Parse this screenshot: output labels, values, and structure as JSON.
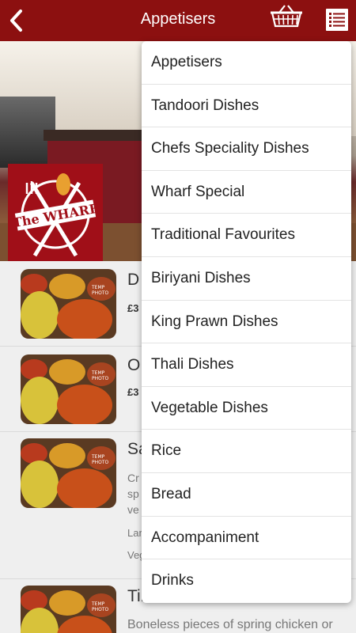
{
  "header": {
    "title": "Appetisers"
  },
  "menu": {
    "items": [
      "Appetisers",
      "Tandoori Dishes",
      "Chefs Speciality Dishes",
      "Wharf Special",
      "Traditional Favourites",
      "Biriyani Dishes",
      "King Prawn Dishes",
      "Thali Dishes",
      "Vegetable Dishes",
      "Rice",
      "Bread",
      "Accompaniment",
      "Drinks"
    ]
  },
  "logo": {
    "text": "The WHARF"
  },
  "list": {
    "items": [
      {
        "title": "D",
        "price": "£3"
      },
      {
        "title": "O",
        "price": "£3"
      },
      {
        "title": "Sa",
        "desc1": "Cr",
        "desc2": "sp",
        "desc3": "ve",
        "meta1": "Lar",
        "meta2": "Veg"
      },
      {
        "title": "Tikka Starter",
        "desc1": "Boneless pieces of spring chicken or"
      }
    ]
  },
  "thumb": {
    "stamp": "TEMP PHOTO"
  },
  "colors": {
    "brand": "#8c1010",
    "background": "#ececec"
  }
}
